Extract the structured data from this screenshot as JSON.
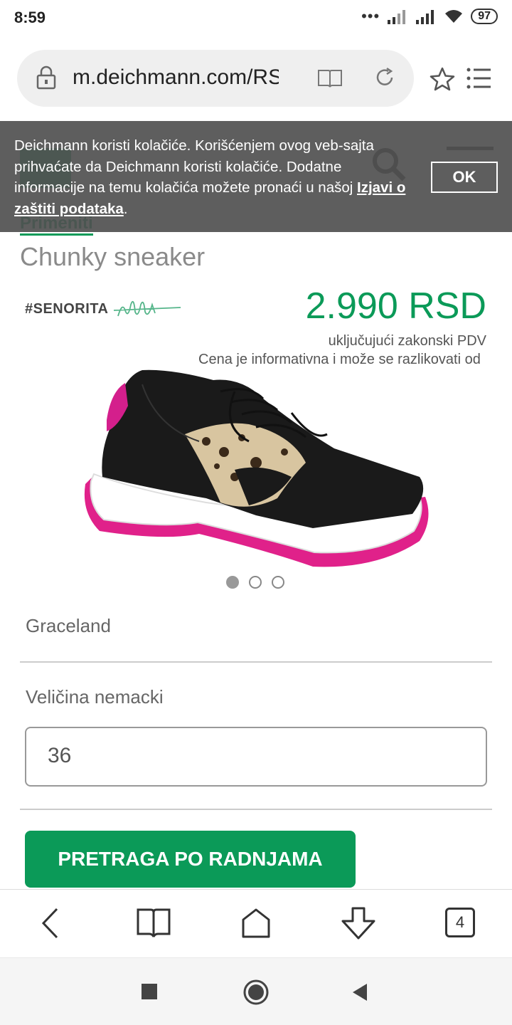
{
  "status_bar": {
    "time": "8:59",
    "battery": "97"
  },
  "browser": {
    "url": "m.deichmann.com/RS",
    "tab_count": "4"
  },
  "page": {
    "apply_link": "Primeniti",
    "product_title": "Chunky sneaker",
    "brand_tag": "#SENORITA",
    "price": "2.990 RSD",
    "vat_note": "uključujući zakonski PDV",
    "price_note": "Cena je informativna i može se razlikovati od",
    "variant_name": "Graceland",
    "size_label": "Veličina nemacki",
    "size_value": "36",
    "store_search_button": "PRETRAGA PO RADNJAMA",
    "carousel": {
      "total": 3,
      "active": 1
    }
  },
  "cookie_banner": {
    "message": "Deichmann koristi kolačiće. Korišćenjem ovog veb-sajta prihvaćate da Deichmann koristi kolačiće. Dodatne informacije na temu kolačića možete pronaći u našoj ",
    "link_text": "Izjavi o zaštiti podataka",
    "tail": ".",
    "ok_label": "OK"
  },
  "colors": {
    "brand_green": "#0b9a58",
    "banner_bg": "#505050"
  }
}
